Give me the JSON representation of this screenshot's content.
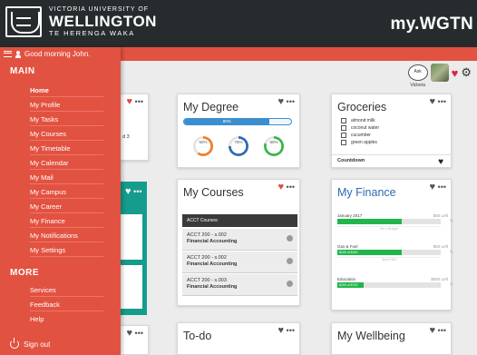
{
  "header": {
    "university_line1": "VICTORIA UNIVERSITY OF",
    "university_name": "WELLINGTON",
    "university_maori": "TE HERENGA WAKA",
    "app_title": "my.WGTN",
    "greeting": "Good morning John."
  },
  "menu": {
    "main_title": "MAIN",
    "main_items": [
      {
        "label": "Home",
        "active": true
      },
      {
        "label": "My Profile"
      },
      {
        "label": "My Tasks"
      },
      {
        "label": "My Courses"
      },
      {
        "label": "My Timetable"
      },
      {
        "label": "My Calendar"
      },
      {
        "label": "My Mail"
      },
      {
        "label": "My Campus"
      },
      {
        "label": "My Career"
      },
      {
        "label": "My Finance"
      },
      {
        "label": "My Notifications"
      },
      {
        "label": "My Settings"
      }
    ],
    "more_title": "MORE",
    "more_items": [
      {
        "label": "Services"
      },
      {
        "label": "Feedback"
      },
      {
        "label": "Help"
      }
    ],
    "signout": "Sign out"
  },
  "toolbar": {
    "ask_label": "Ask Victoria"
  },
  "cards": {
    "partial_left_text": "d 3",
    "degree": {
      "title": "My Degree",
      "progress_label": "80%",
      "progress": 0.8,
      "rings": [
        {
          "label": "60%",
          "value": 0.6,
          "color": "#f07d28"
        },
        {
          "label": "75%",
          "value": 0.75,
          "color": "#2c6bb0"
        },
        {
          "label": "80%",
          "value": 0.8,
          "color": "#3cb44b"
        }
      ]
    },
    "groceries": {
      "title": "Groceries",
      "items": [
        "almond milk",
        "coconut water",
        "cucumber",
        "green apples"
      ],
      "footer": "Countdown"
    },
    "courses": {
      "title": "My Courses",
      "header": "ACCT Courses:",
      "items": [
        {
          "code": "ACCT 200 - s.002",
          "name": "Financial Accounting"
        },
        {
          "code": "ACCT 200 - s.002",
          "name": "Financial Accounting"
        },
        {
          "code": "ACCT 200 - s.003",
          "name": "Financial Accounting"
        }
      ]
    },
    "finance": {
      "title": "My Finance",
      "rows": [
        {
          "label": "January 2017",
          "amount": "$60 Left",
          "fill_text": "",
          "value": 0.62,
          "sub": "Set a Budget"
        },
        {
          "label": "Gas & Fuel",
          "amount": "$60 Left",
          "fill_text": "$100 of $160",
          "value": 0.62,
          "sub": "Spent $60"
        },
        {
          "label": "Education",
          "amount": "$500 Left",
          "fill_text": "$200 of $700",
          "value": 0.25,
          "sub": ""
        }
      ]
    },
    "todo": {
      "title": "To-do"
    },
    "wellbeing": {
      "title": "My Wellbeing"
    }
  },
  "colors": {
    "header_bg": "#262c2e",
    "accent_red": "#e25241",
    "teal": "#159c8c",
    "finance_green": "#21b64b"
  }
}
